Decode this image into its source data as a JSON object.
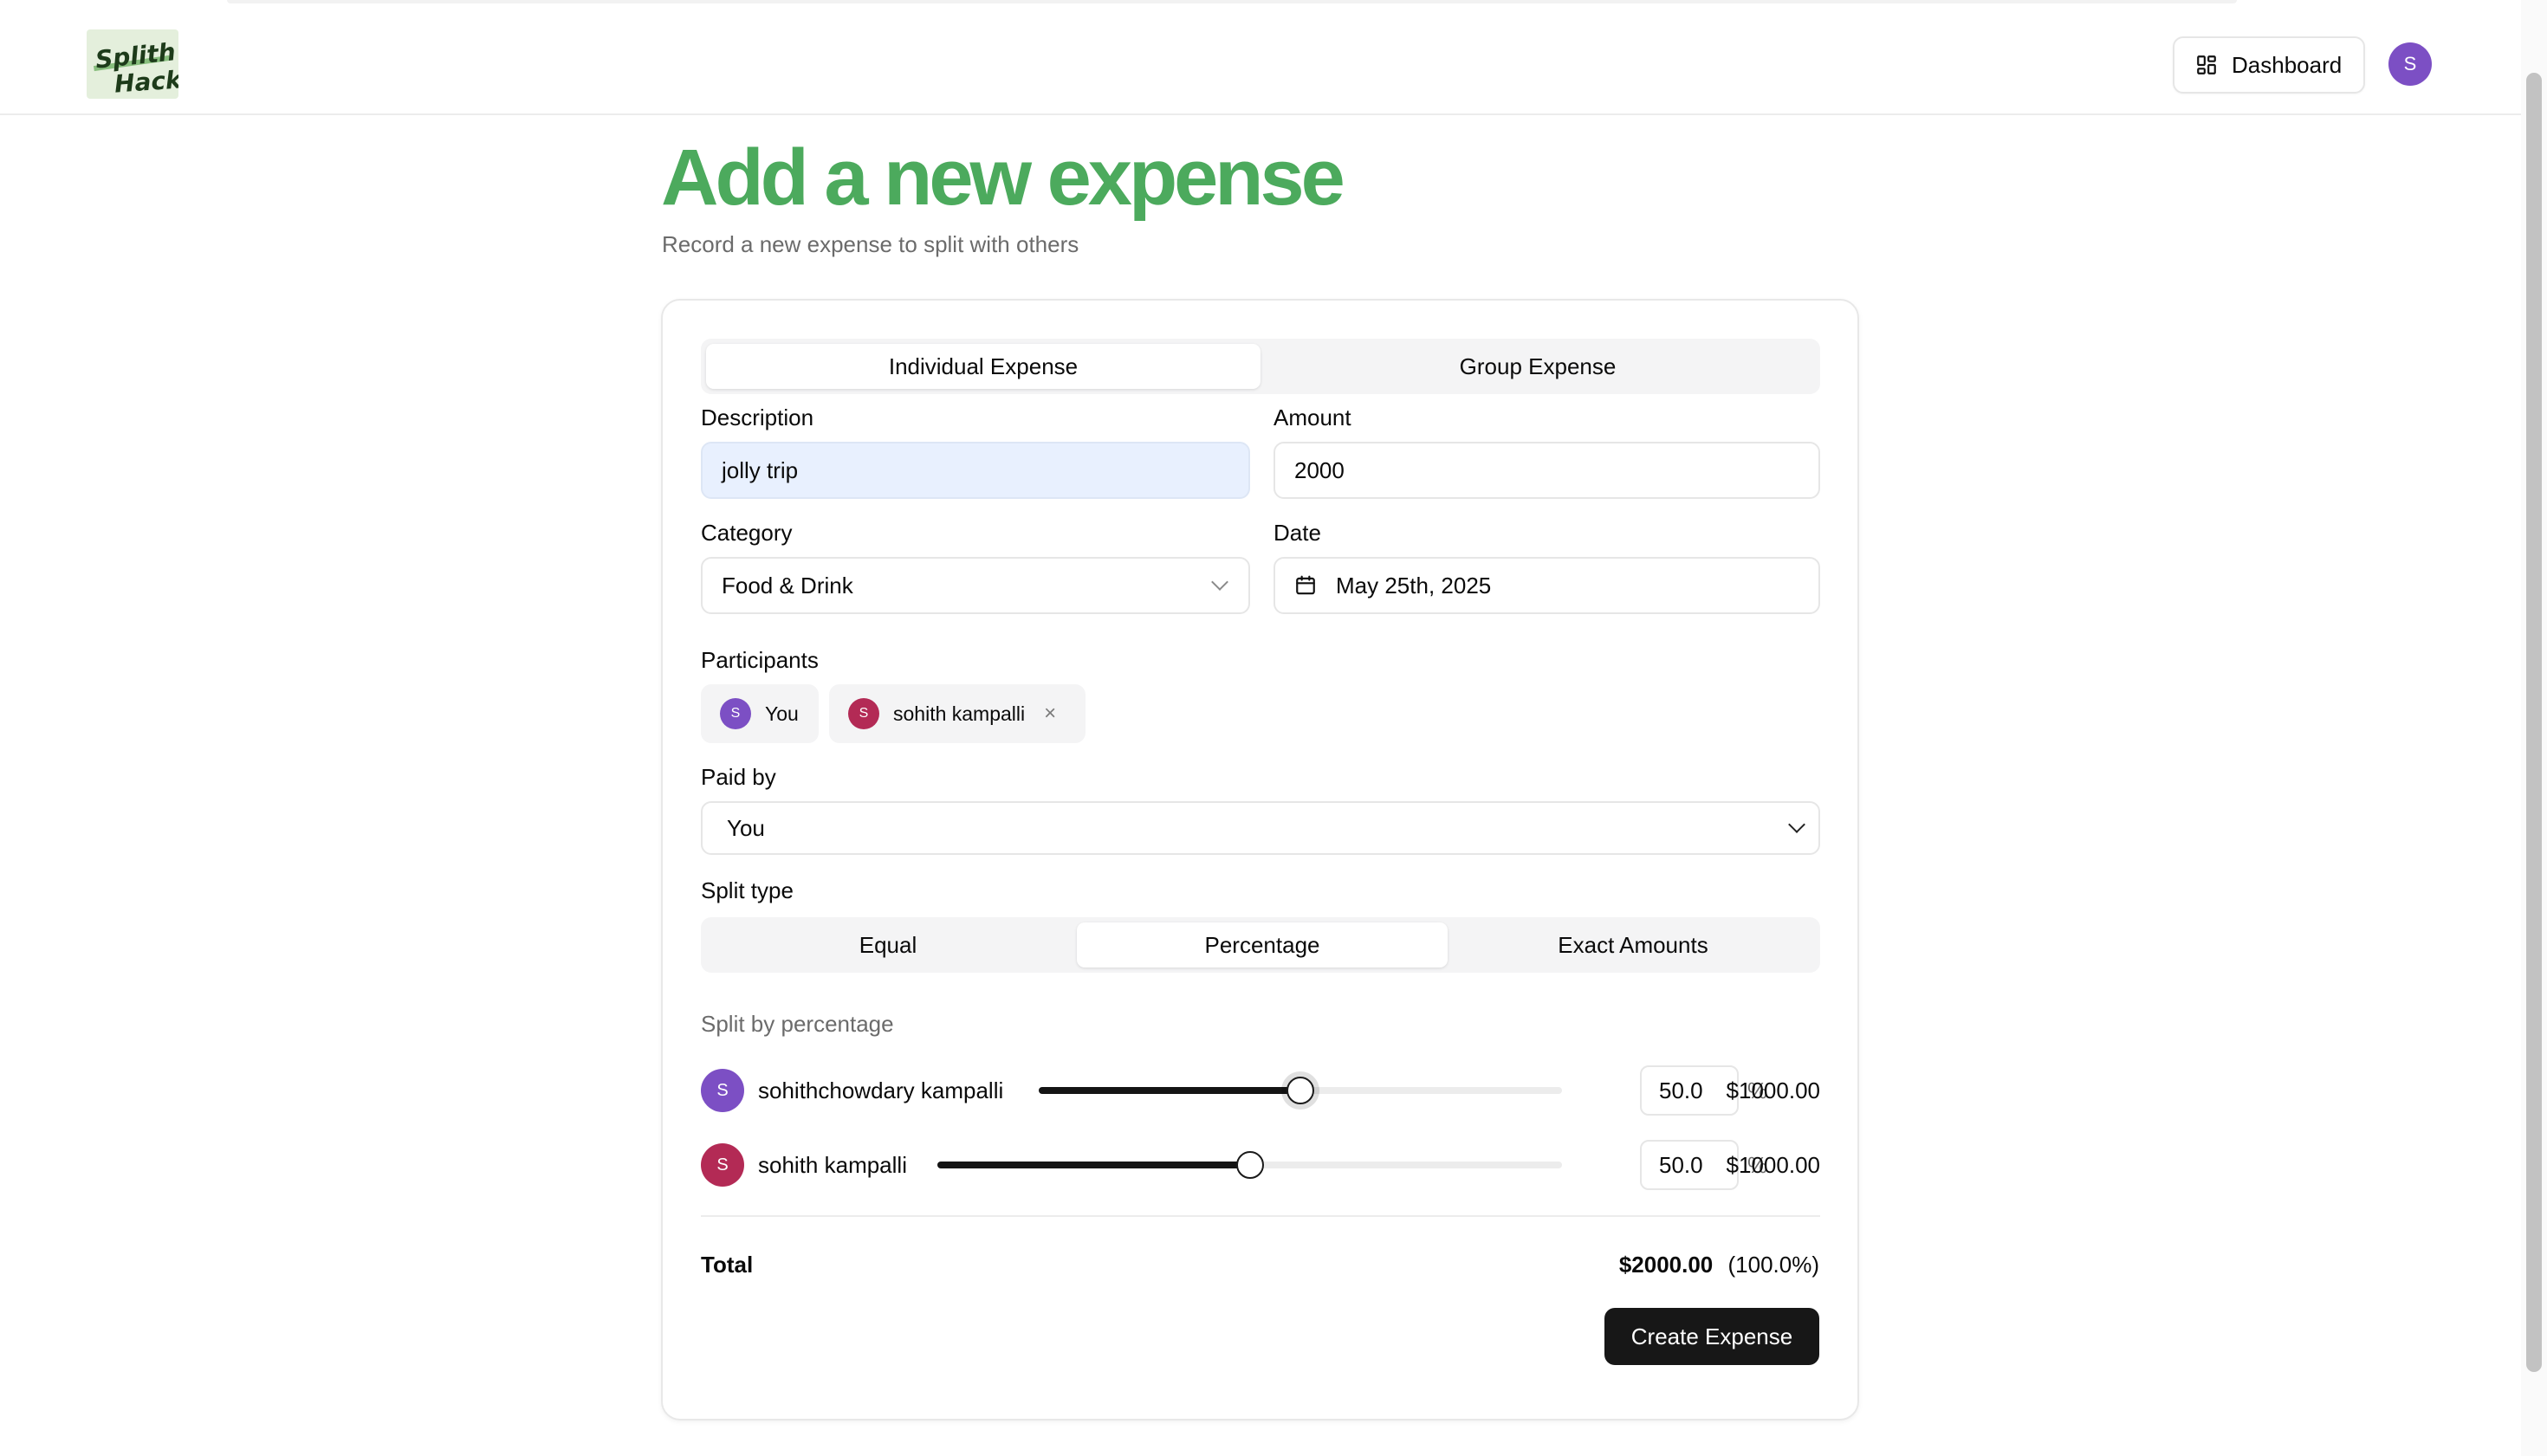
{
  "header": {
    "logo_line1": "Splith",
    "logo_line2": "Hack",
    "dashboard_label": "Dashboard",
    "avatar_initial": "S"
  },
  "page": {
    "title": "Add a new expense",
    "subtitle": "Record a new expense to split with others"
  },
  "tabs": [
    {
      "label": "Individual Expense",
      "active": true
    },
    {
      "label": "Group Expense",
      "active": false
    }
  ],
  "form": {
    "description_label": "Description",
    "description_value": "jolly trip",
    "amount_label": "Amount",
    "amount_value": "2000",
    "category_label": "Category",
    "category_value": "Food & Drink",
    "date_label": "Date",
    "date_value": "May 25th, 2025",
    "participants_label": "Participants",
    "participants": [
      {
        "initial": "S",
        "name": "You",
        "removable": false
      },
      {
        "initial": "S",
        "name": "sohith kampalli",
        "removable": true
      }
    ],
    "remove_glyph": "×",
    "paid_by_label": "Paid by",
    "paid_by_value": "You",
    "split_type_label": "Split type",
    "split_types": [
      {
        "label": "Equal",
        "active": false
      },
      {
        "label": "Percentage",
        "active": true
      },
      {
        "label": "Exact Amounts",
        "active": false
      }
    ]
  },
  "split": {
    "note": "Split by percentage",
    "rows": [
      {
        "initial": "S",
        "name": "sohithchowdary kampalli",
        "percent": 50,
        "percent_display": "50.0",
        "pct_sign": "%",
        "amount": "$1000.00"
      },
      {
        "initial": "S",
        "name": "sohith kampalli",
        "percent": 50,
        "percent_display": "50.0",
        "pct_sign": "%",
        "amount": "$1000.00"
      }
    ],
    "total_label": "Total",
    "total_amount": "$2000.00",
    "total_percent": "(100.0%)"
  },
  "actions": {
    "create_label": "Create Expense"
  },
  "colors": {
    "brand_green": "#4caa5d",
    "avatar_purple": "#7c4fc4",
    "avatar_crimson": "#b32a55",
    "primary_button": "#171717"
  }
}
